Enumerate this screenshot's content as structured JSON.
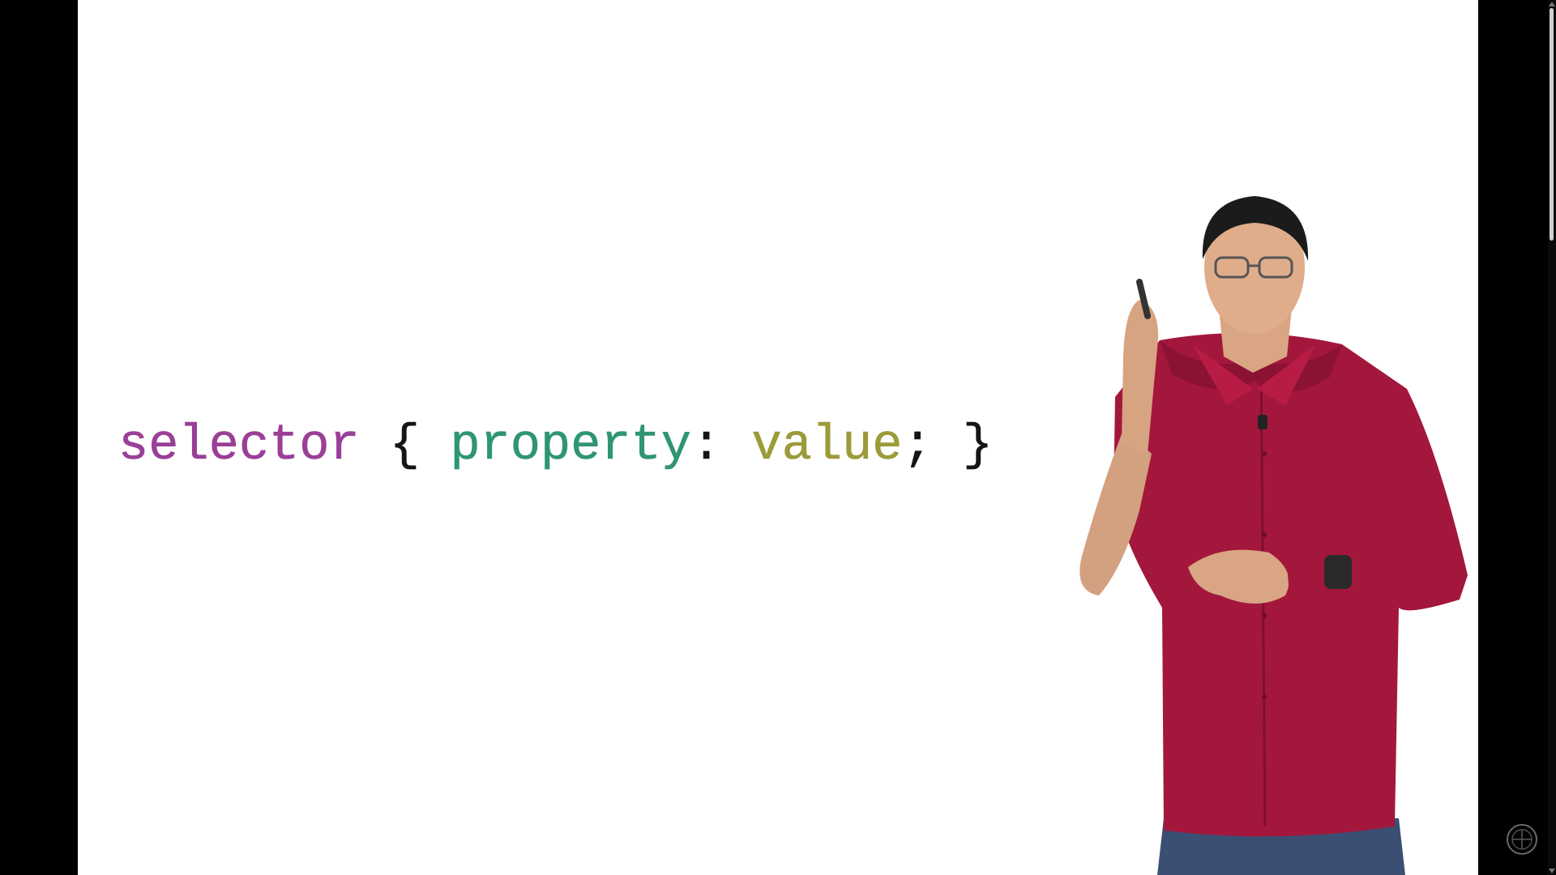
{
  "video": {
    "code": {
      "selector": "selector",
      "open_brace": "{",
      "property": "property",
      "colon": ":",
      "value": "value",
      "semicolon": ";",
      "close_brace": "}"
    },
    "colors": {
      "selector": "#9a3f97",
      "property": "#2f9574",
      "value": "#9c9a39",
      "punctuation": "#151515",
      "background": "#ffffff",
      "letterbox": "#000000"
    },
    "icons": [
      "channel-watermark-icon"
    ]
  }
}
